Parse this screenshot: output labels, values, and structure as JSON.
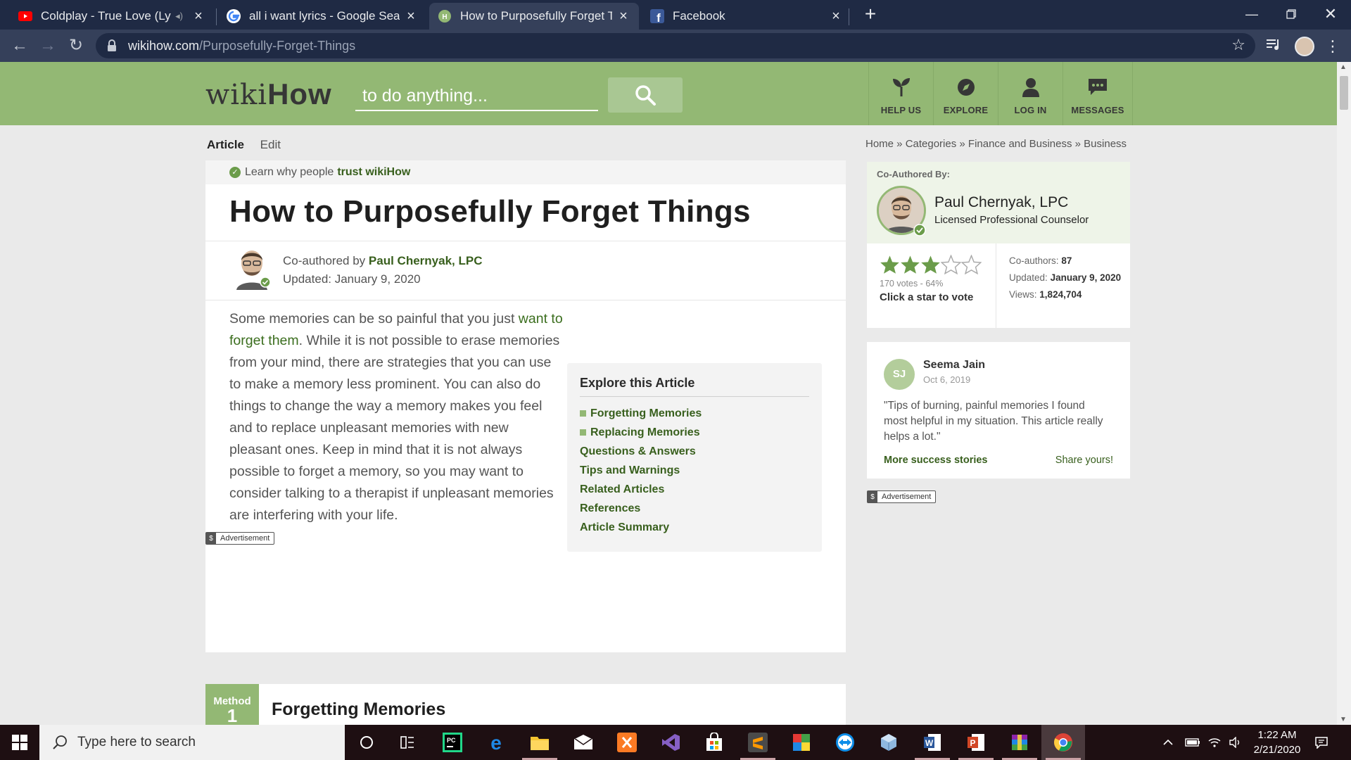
{
  "browser": {
    "tabs": [
      {
        "title": "Coldplay - True Love (Lyrics V",
        "favicon": "youtube-icon",
        "audio": "◂)",
        "active": false
      },
      {
        "title": "all i want lyrics - Google Search",
        "favicon": "google-icon",
        "active": false
      },
      {
        "title": "How to Purposefully Forget Thing",
        "favicon": "wikihow-icon",
        "active": true
      },
      {
        "title": "Facebook",
        "favicon": "facebook-icon",
        "active": false
      }
    ],
    "url_domain": "wikihow.com",
    "url_path": "/Purposefully-Forget-Things"
  },
  "site": {
    "logo_wiki": "wiki",
    "logo_how": "How",
    "search_placeholder": "to do anything...",
    "nav": [
      {
        "label": "HELP US",
        "icon": "sprout-icon"
      },
      {
        "label": "EXPLORE",
        "icon": "compass-icon"
      },
      {
        "label": "LOG IN",
        "icon": "user-icon"
      },
      {
        "label": "MESSAGES",
        "icon": "chat-bubble-icon"
      }
    ]
  },
  "article": {
    "tab_article": "Article",
    "tab_edit": "Edit",
    "trust_text": "Learn why people",
    "trust_link": "trust wikiHow",
    "title": "How to Purposefully Forget Things",
    "coauthored_prefix": "Co-authored by",
    "author": "Paul Chernyak, LPC",
    "updated": "Updated: January 9, 2020",
    "intro_before": "Some memories can be so painful that you just ",
    "intro_link": "want to forget them",
    "intro_after": ". While it is not possible to erase memories from your mind, there are strategies that you can use to make a memory less prominent. You can also do things to change the way a memory makes you feel and to replace unpleasant memories with new pleasant ones. Keep in mind that it is not always possible to forget a memory, so you may want to consider talking to a therapist if unpleasant memories are interfering with your life.",
    "advertisement": "Advertisement",
    "explore": {
      "heading": "Explore this Article",
      "items": [
        {
          "label": "Forgetting Memories",
          "bullet": true
        },
        {
          "label": "Replacing Memories",
          "bullet": true
        },
        {
          "label": "Questions & Answers",
          "bullet": false
        },
        {
          "label": "Tips and Warnings",
          "bullet": false
        },
        {
          "label": "Related Articles",
          "bullet": false
        },
        {
          "label": "References",
          "bullet": false
        },
        {
          "label": "Article Summary",
          "bullet": false
        }
      ]
    },
    "method": {
      "label": "Method",
      "number": "1",
      "title": "Forgetting Memories"
    }
  },
  "sidebar": {
    "breadcrumb": "Home » Categories » Finance and Business » Business",
    "coauthor_label": "Co-Authored By:",
    "coauthor_name": "Paul Chernyak, LPC",
    "coauthor_role": "Licensed Professional Counselor",
    "rating": 0.64,
    "votes": "170 votes - 64%",
    "vote_prompt": "Click a star to vote",
    "coauthors_label": "Co-authors:",
    "coauthors_value": "87",
    "updated_label": "Updated:",
    "updated_value": "January 9, 2020",
    "views_label": "Views:",
    "views_value": "1,824,704",
    "story": {
      "initials": "SJ",
      "name": "Seema Jain",
      "date": "Oct 6, 2019",
      "quote": "\"Tips of burning, painful memories I found most helpful in my situation. This article really helps a lot.\"",
      "more": "More success stories",
      "share": "Share yours!"
    },
    "advertisement": "Advertisement"
  },
  "taskbar": {
    "search_placeholder": "Type here to search",
    "time": "1:22 AM",
    "date": "2/21/2020",
    "apps": [
      "cortana-icon",
      "task-view-icon",
      "pycharm-icon",
      "edge-icon",
      "file-explorer-icon",
      "mail-icon",
      "xampp-icon",
      "visual-studio-icon",
      "store-icon",
      "sublime-text-icon",
      "winrar-icon",
      "teamviewer-icon",
      "virtualbox-icon",
      "word-icon",
      "powerpoint-icon",
      "winrar-archive-icon",
      "chrome-icon"
    ]
  },
  "colors": {
    "wikihow_green": "#93b874",
    "link_green": "#385f1d",
    "chrome_dark": "#1f2a44",
    "taskbar": "#1e0f12"
  }
}
